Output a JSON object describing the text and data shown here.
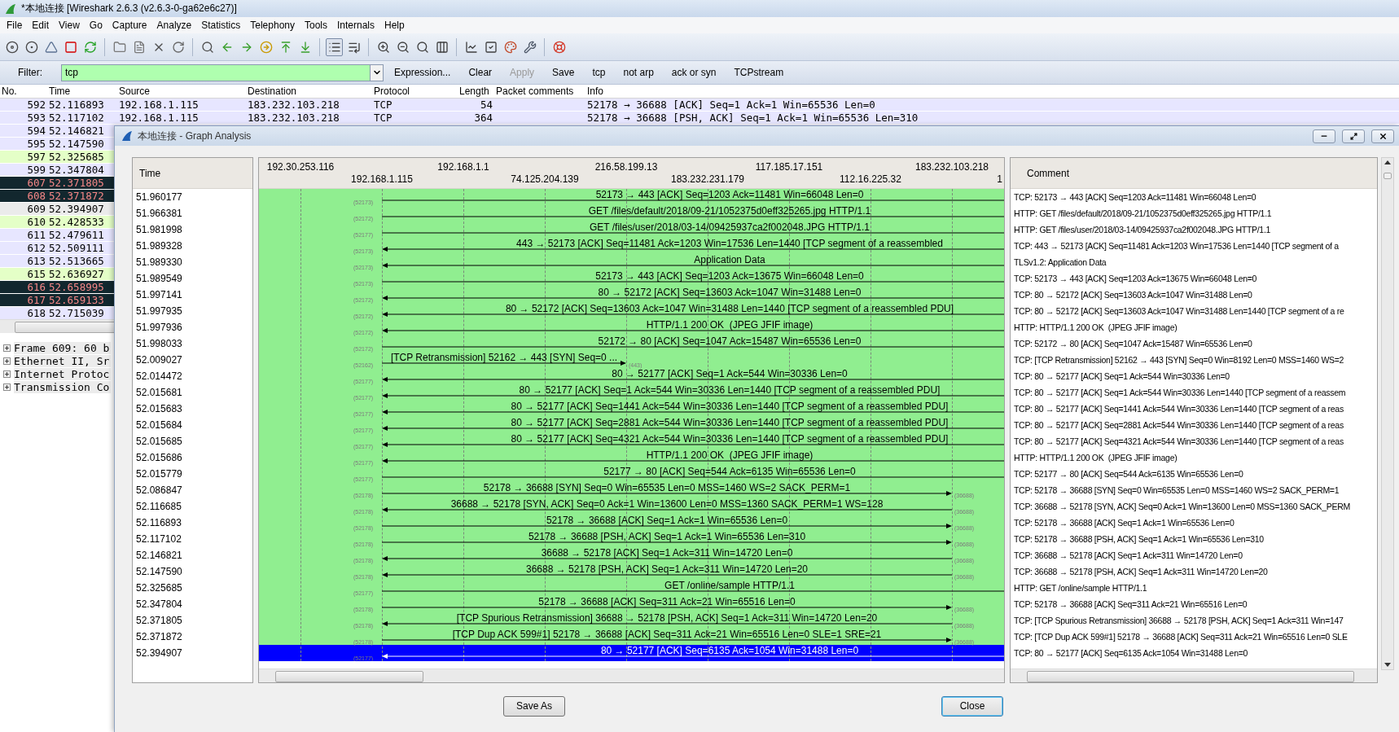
{
  "window": {
    "title": "*本地连接 [Wireshark 2.6.3 (v2.6.3-0-ga62e6c27)]"
  },
  "menu": [
    "File",
    "Edit",
    "View",
    "Go",
    "Capture",
    "Analyze",
    "Statistics",
    "Telephony",
    "Tools",
    "Internals",
    "Help"
  ],
  "toolbar": [
    {
      "pressed": false
    },
    {
      "pressed": false
    },
    {
      "pressed": false
    },
    {
      "pressed": false
    },
    {
      "pressed": false
    },
    {
      "pressed": false
    },
    {
      "pressed": false
    },
    {
      "pressed": false
    },
    {
      "pressed": false
    },
    {
      "pressed": false
    },
    {
      "pressed": false
    },
    {
      "pressed": false
    },
    {
      "pressed": false
    },
    {
      "pressed": false
    },
    {
      "pressed": false
    },
    {
      "pressed": true
    },
    {
      "pressed": false
    },
    {
      "pressed": false
    },
    {
      "pressed": false
    },
    {
      "pressed": false
    },
    {
      "pressed": false
    },
    {
      "pressed": false
    },
    {
      "pressed": false
    },
    {
      "pressed": false
    },
    {
      "pressed": false
    },
    {
      "pressed": false
    }
  ],
  "filter": {
    "label": "Filter:",
    "value": "tcp",
    "valid": true,
    "buttons": [
      {
        "label": "Expression...",
        "disabled": false
      },
      {
        "label": "Clear",
        "disabled": false
      },
      {
        "label": "Apply",
        "disabled": true
      },
      {
        "label": "Save",
        "disabled": false
      },
      {
        "label": "tcp",
        "disabled": false
      },
      {
        "label": "not arp",
        "disabled": false
      },
      {
        "label": "ack or syn",
        "disabled": false
      },
      {
        "label": "TCPstream",
        "disabled": false
      }
    ]
  },
  "packet_list": {
    "columns": [
      "No.",
      "Time",
      "Source",
      "Destination",
      "Protocol",
      "Length",
      "Packet comments",
      "Info"
    ],
    "rows": [
      {
        "no": "592",
        "time": "52.116893",
        "source": "192.168.1.115",
        "destination": "183.232.103.218",
        "protocol": "TCP",
        "length": "54",
        "info": "52178 → 36688 [ACK] Seq=1 Ack=1 Win=65536 Len=0",
        "color": "#e7e6ff",
        "selected": false
      },
      {
        "no": "593",
        "time": "52.117102",
        "source": "192.168.1.115",
        "destination": "183.232.103.218",
        "protocol": "TCP",
        "length": "364",
        "info": "52178 → 36688 [PSH, ACK] Seq=1 Ack=1 Win=65536 Len=310",
        "color": "#e7e6ff",
        "selected": false
      },
      {
        "no": "594",
        "time": "52.146821",
        "color": "#e7e6ff",
        "selected": false
      },
      {
        "no": "595",
        "time": "52.147590",
        "color": "#e7e6ff",
        "selected": false
      },
      {
        "no": "597",
        "time": "52.325685",
        "color": "#e4ffc7",
        "selected": false
      },
      {
        "no": "599",
        "time": "52.347804",
        "color": "#e7e6ff",
        "selected": false
      },
      {
        "no": "607",
        "time": "52.371805",
        "color": "#12272e",
        "selected": false
      },
      {
        "no": "608",
        "time": "52.371872",
        "color": "#12272e",
        "selected": false
      },
      {
        "no": "609",
        "time": "52.394907",
        "selected": true
      },
      {
        "no": "610",
        "time": "52.428533",
        "color": "#e4ffc7",
        "selected": false
      },
      {
        "no": "611",
        "time": "52.479611",
        "color": "#e7e6ff",
        "selected": false
      },
      {
        "no": "612",
        "time": "52.509111",
        "color": "#e7e6ff",
        "selected": false
      },
      {
        "no": "613",
        "time": "52.513665",
        "color": "#e7e6ff",
        "selected": false
      },
      {
        "no": "615",
        "time": "52.636927",
        "color": "#e4ffc7",
        "selected": false
      },
      {
        "no": "616",
        "time": "52.658995",
        "color": "#12272e",
        "selected": false
      },
      {
        "no": "617",
        "time": "52.659133",
        "color": "#12272e",
        "selected": false
      },
      {
        "no": "618",
        "time": "52.715039",
        "color": "#e7e6ff",
        "selected": false
      }
    ]
  },
  "packet_details": [
    {
      "label": "Frame 609: 60 b",
      "expanded": false
    },
    {
      "label": "Ethernet II, Sr",
      "expanded": false
    },
    {
      "label": "Internet Protoc",
      "expanded": false
    },
    {
      "label": "Transmission Co",
      "expanded": false
    }
  ],
  "dialog": {
    "title": "本地连接 - Graph Analysis",
    "time_header": "Time",
    "comment_header": "Comment",
    "nodes": [
      {
        "address": "192.30.253.116",
        "clipped": false
      },
      {
        "address": "192.168.1.115",
        "clipped": false
      },
      {
        "address": "192.168.1.1",
        "clipped": false
      },
      {
        "address": "74.125.204.139",
        "clipped": false
      },
      {
        "address": "216.58.199.13",
        "clipped": false
      },
      {
        "address": "183.232.231.179",
        "clipped": false
      },
      {
        "address": "117.185.17.151",
        "clipped": false
      },
      {
        "address": "112.16.225.32",
        "clipped": false
      },
      {
        "address": "183.232.103.218",
        "clipped": false
      },
      {
        "address": "1",
        "clipped": true
      }
    ],
    "messages": [
      {
        "time": "51.960177",
        "label": "52173 → 443 [ACK] Seq=1203 Ack=11481 Win=66048 Len=0",
        "kind": "edge",
        "incoming": false,
        "host_port": "(52173)",
        "comment": "TCP: 52173 → 443 [ACK] Seq=1203 Ack=11481 Win=66048 Len=0",
        "selected": false
      },
      {
        "time": "51.966381",
        "label": "GET /files/default/2018/09-21/1052375d0eff325265.jpg HTTP/1.1",
        "kind": "edge",
        "incoming": false,
        "host_port": "(52172)",
        "comment": "HTTP: GET /files/default/2018/09-21/1052375d0eff325265.jpg HTTP/1.1",
        "selected": false
      },
      {
        "time": "51.981998",
        "label": "GET /files/user/2018/03-14/09425937ca2f002048.JPG HTTP/1.1",
        "kind": "edge",
        "incoming": false,
        "host_port": "(52177)",
        "comment": "HTTP: GET /files/user/2018/03-14/09425937ca2f002048.JPG HTTP/1.1",
        "selected": false
      },
      {
        "time": "51.989328",
        "label": "443 → 52173 [ACK] Seq=11481 Ack=1203 Win=17536 Len=1440 [TCP segment of a reassembled",
        "kind": "edge",
        "incoming": true,
        "host_port": "(52173)",
        "comment": "TCP: 443 → 52173 [ACK] Seq=11481 Ack=1203 Win=17536 Len=1440 [TCP segment of a",
        "selected": false
      },
      {
        "time": "51.989330",
        "label": "Application Data",
        "kind": "edge",
        "incoming": true,
        "host_port": "(52173)",
        "comment": "TLSv1.2: Application Data",
        "selected": false
      },
      {
        "time": "51.989549",
        "label": "52173 → 443 [ACK] Seq=1203 Ack=13675 Win=66048 Len=0",
        "kind": "edge",
        "incoming": false,
        "host_port": "(52173)",
        "comment": "TCP: 52173 → 443 [ACK] Seq=1203 Ack=13675 Win=66048 Len=0",
        "selected": false
      },
      {
        "time": "51.997141",
        "label": "80 → 52172 [ACK] Seq=13603 Ack=1047 Win=31488 Len=0",
        "kind": "edge",
        "incoming": true,
        "host_port": "(52172)",
        "comment": "TCP: 80 → 52172 [ACK] Seq=13603 Ack=1047 Win=31488 Len=0",
        "selected": false
      },
      {
        "time": "51.997935",
        "label": "80 → 52172 [ACK] Seq=13603 Ack=1047 Win=31488 Len=1440 [TCP segment of a reassembled PDU]",
        "kind": "edge",
        "incoming": true,
        "host_port": "(52172)",
        "comment": "TCP: 80 → 52172 [ACK] Seq=13603 Ack=1047 Win=31488 Len=1440 [TCP segment of a re",
        "selected": false
      },
      {
        "time": "51.997936",
        "label": "HTTP/1.1 200 OK  (JPEG JFIF image)",
        "kind": "edge",
        "incoming": true,
        "host_port": "(52172)",
        "comment": "HTTP: HTTP/1.1 200 OK  (JPEG JFIF image)",
        "selected": false
      },
      {
        "time": "51.998033",
        "label": "52172 → 80 [ACK] Seq=1047 Ack=15487 Win=65536 Len=0",
        "kind": "edge",
        "incoming": false,
        "host_port": "(52172)",
        "comment": "TCP: 52172 → 80 [ACK] Seq=1047 Ack=15487 Win=65536 Len=0",
        "selected": false
      },
      {
        "time": "52.009027",
        "label": "[TCP Retransmission] 52162 → 443 [SYN] Seq=0 ...",
        "kind": "short",
        "incoming": false,
        "host_port": "(52162)",
        "peer_port": "(443)",
        "comment": "TCP: [TCP Retransmission] 52162 → 443 [SYN] Seq=0 Win=8192 Len=0 MSS=1460 WS=2",
        "selected": false
      },
      {
        "time": "52.014472",
        "label": "80 → 52177 [ACK] Seq=1 Ack=544 Win=30336 Len=0",
        "kind": "edge",
        "incoming": true,
        "host_port": "(52177)",
        "comment": "TCP: 80 → 52177 [ACK] Seq=1 Ack=544 Win=30336 Len=0",
        "selected": false
      },
      {
        "time": "52.015681",
        "label": "80 → 52177 [ACK] Seq=1 Ack=544 Win=30336 Len=1440 [TCP segment of a reassembled PDU]",
        "kind": "edge",
        "incoming": true,
        "host_port": "(52177)",
        "comment": "TCP: 80 → 52177 [ACK] Seq=1 Ack=544 Win=30336 Len=1440 [TCP segment of a reassem",
        "selected": false
      },
      {
        "time": "52.015683",
        "label": "80 → 52177 [ACK] Seq=1441 Ack=544 Win=30336 Len=1440 [TCP segment of a reassembled PDU]",
        "kind": "edge",
        "incoming": true,
        "host_port": "(52177)",
        "comment": "TCP: 80 → 52177 [ACK] Seq=1441 Ack=544 Win=30336 Len=1440 [TCP segment of a reas",
        "selected": false
      },
      {
        "time": "52.015684",
        "label": "80 → 52177 [ACK] Seq=2881 Ack=544 Win=30336 Len=1440 [TCP segment of a reassembled PDU]",
        "kind": "edge",
        "incoming": true,
        "host_port": "(52177)",
        "comment": "TCP: 80 → 52177 [ACK] Seq=2881 Ack=544 Win=30336 Len=1440 [TCP segment of a reas",
        "selected": false
      },
      {
        "time": "52.015685",
        "label": "80 → 52177 [ACK] Seq=4321 Ack=544 Win=30336 Len=1440 [TCP segment of a reassembled PDU]",
        "kind": "edge",
        "incoming": true,
        "host_port": "(52177)",
        "comment": "TCP: 80 → 52177 [ACK] Seq=4321 Ack=544 Win=30336 Len=1440 [TCP segment of a reas",
        "selected": false
      },
      {
        "time": "52.015686",
        "label": "HTTP/1.1 200 OK  (JPEG JFIF image)",
        "kind": "edge",
        "incoming": true,
        "host_port": "(52177)",
        "comment": "HTTP: HTTP/1.1 200 OK  (JPEG JFIF image)",
        "selected": false
      },
      {
        "time": "52.015779",
        "label": "52177 → 80 [ACK] Seq=544 Ack=6135 Win=65536 Len=0",
        "kind": "edge",
        "incoming": false,
        "host_port": "(52177)",
        "comment": "TCP: 52177 → 80 [ACK] Seq=544 Ack=6135 Win=65536 Len=0",
        "selected": false
      },
      {
        "time": "52.086847",
        "label": "52178 → 36688 [SYN] Seq=0 Win=65535 Len=0 MSS=1460 WS=2 SACK_PERM=1",
        "kind": "long",
        "incoming": false,
        "host_port": "(52178)",
        "peer_port": "(36688)",
        "comment": "TCP: 52178 → 36688 [SYN] Seq=0 Win=65535 Len=0 MSS=1460 WS=2 SACK_PERM=1",
        "selected": false
      },
      {
        "time": "52.116685",
        "label": "36688 → 52178 [SYN, ACK] Seq=0 Ack=1 Win=13600 Len=0 MSS=1360 SACK_PERM=1 WS=128",
        "kind": "long",
        "incoming": true,
        "host_port": "(52178)",
        "peer_port": "(36688)",
        "comment": "TCP: 36688 → 52178 [SYN, ACK] Seq=0 Ack=1 Win=13600 Len=0 MSS=1360 SACK_PERM",
        "selected": false
      },
      {
        "time": "52.116893",
        "label": "52178 → 36688 [ACK] Seq=1 Ack=1 Win=65536 Len=0",
        "kind": "long",
        "incoming": false,
        "host_port": "(52178)",
        "peer_port": "(36688)",
        "comment": "TCP: 52178 → 36688 [ACK] Seq=1 Ack=1 Win=65536 Len=0",
        "selected": false
      },
      {
        "time": "52.117102",
        "label": "52178 → 36688 [PSH, ACK] Seq=1 Ack=1 Win=65536 Len=310",
        "kind": "long",
        "incoming": false,
        "host_port": "(52178)",
        "peer_port": "(36688)",
        "comment": "TCP: 52178 → 36688 [PSH, ACK] Seq=1 Ack=1 Win=65536 Len=310",
        "selected": false
      },
      {
        "time": "52.146821",
        "label": "36688 → 52178 [ACK] Seq=1 Ack=311 Win=14720 Len=0",
        "kind": "long",
        "incoming": true,
        "host_port": "(52178)",
        "peer_port": "(36688)",
        "comment": "TCP: 36688 → 52178 [ACK] Seq=1 Ack=311 Win=14720 Len=0",
        "selected": false
      },
      {
        "time": "52.147590",
        "label": "36688 → 52178 [PSH, ACK] Seq=1 Ack=311 Win=14720 Len=20",
        "kind": "long",
        "incoming": true,
        "host_port": "(52178)",
        "peer_port": "(36688)",
        "comment": "TCP: 36688 → 52178 [PSH, ACK] Seq=1 Ack=311 Win=14720 Len=20",
        "selected": false
      },
      {
        "time": "52.325685",
        "label": "GET /online/sample HTTP/1.1",
        "kind": "edge",
        "incoming": false,
        "host_port": "(52177)",
        "comment": "HTTP: GET /online/sample HTTP/1.1",
        "selected": false
      },
      {
        "time": "52.347804",
        "label": "52178 → 36688 [ACK] Seq=311 Ack=21 Win=65516 Len=0",
        "kind": "long",
        "incoming": false,
        "host_port": "(52178)",
        "peer_port": "(36688)",
        "comment": "TCP: 52178 → 36688 [ACK] Seq=311 Ack=21 Win=65516 Len=0",
        "selected": false
      },
      {
        "time": "52.371805",
        "label": "[TCP Spurious Retransmission] 36688 → 52178 [PSH, ACK] Seq=1 Ack=311 Win=14720 Len=20",
        "kind": "long",
        "incoming": true,
        "host_port": "(52178)",
        "peer_port": "(36688)",
        "comment": "TCP: [TCP Spurious Retransmission] 36688 → 52178 [PSH, ACK] Seq=1 Ack=311 Win=147",
        "selected": false
      },
      {
        "time": "52.371872",
        "label": "[TCP Dup ACK 599#1] 52178 → 36688 [ACK] Seq=311 Ack=21 Win=65516 Len=0 SLE=1 SRE=21",
        "kind": "long",
        "incoming": false,
        "host_port": "(52178)",
        "peer_port": "(36688)",
        "comment": "TCP: [TCP Dup ACK 599#1] 52178 → 36688 [ACK] Seq=311 Ack=21 Win=65516 Len=0 SLE",
        "selected": false
      },
      {
        "time": "52.394907",
        "label": "80 → 52177 [ACK] Seq=6135 Ack=1054 Win=31488 Len=0",
        "kind": "edge",
        "incoming": true,
        "host_port": "(52177)",
        "comment": "TCP: 80 → 52177 [ACK] Seq=6135 Ack=1054 Win=31488 Len=0",
        "selected": true
      }
    ],
    "buttons": [
      {
        "label": "Save As",
        "focused": false
      },
      {
        "label": "Close",
        "focused": true
      }
    ]
  }
}
